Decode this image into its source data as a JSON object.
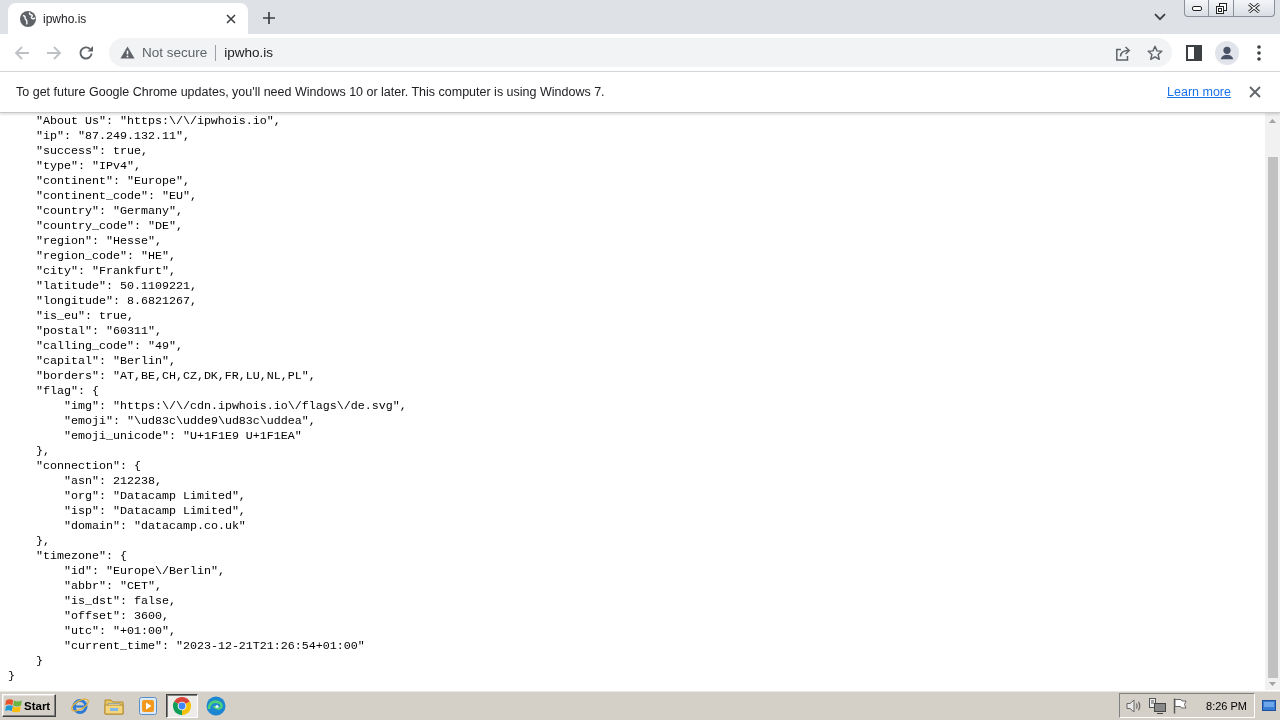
{
  "browser": {
    "tabs": [
      {
        "title": "ipwho.is",
        "selected": true
      }
    ],
    "toolbar": {
      "back": {
        "disabled": true
      },
      "forward": {
        "disabled": true
      }
    },
    "address_bar": {
      "security_label": "Not secure",
      "url": "ipwho.is"
    },
    "infobar": {
      "message": "To get future Google Chrome updates, you'll need Windows 10 or later. This computer is using Windows 7.",
      "link": "Learn more"
    }
  },
  "page": {
    "entries": [
      {
        "text": "\"About Us\": \"https:\\/\\/ipwhois.io\","
      },
      {
        "text": "\"ip\": \"87.249.132.11\","
      },
      {
        "text": "\"success\": true,"
      },
      {
        "text": "\"type\": \"IPv4\","
      },
      {
        "text": "\"continent\": \"Europe\","
      },
      {
        "text": "\"continent_code\": \"EU\","
      },
      {
        "text": "\"country\": \"Germany\","
      },
      {
        "text": "\"country_code\": \"DE\","
      },
      {
        "text": "\"region\": \"Hesse\","
      },
      {
        "text": "\"region_code\": \"HE\","
      },
      {
        "text": "\"city\": \"Frankfurt\","
      },
      {
        "text": "\"latitude\": 50.1109221,"
      },
      {
        "text": "\"longitude\": 8.6821267,"
      },
      {
        "text": "\"is_eu\": true,"
      },
      {
        "text": "\"postal\": \"60311\","
      },
      {
        "text": "\"calling_code\": \"49\","
      },
      {
        "text": "\"capital\": \"Berlin\","
      },
      {
        "text": "\"borders\": \"AT,BE,CH,CZ,DK,FR,LU,NL,PL\","
      },
      {
        "text": "\"flag\": {",
        "children": [
          {
            "text": "\"img\": \"https:\\/\\/cdn.ipwhois.io\\/flags\\/de.svg\","
          },
          {
            "text": "\"emoji\": \"\\ud83c\\udde9\\ud83c\\uddea\","
          },
          {
            "text": "\"emoji_unicode\": \"U+1F1E9 U+1F1EA\""
          }
        ],
        "close": "},"
      },
      {
        "text": "\"connection\": {",
        "children": [
          {
            "text": "\"asn\": 212238,"
          },
          {
            "text": "\"org\": \"Datacamp Limited\","
          },
          {
            "text": "\"isp\": \"Datacamp Limited\","
          },
          {
            "text": "\"domain\": \"datacamp.co.uk\""
          }
        ],
        "close": "},"
      },
      {
        "text": "\"timezone\": {",
        "children": [
          {
            "text": "\"id\": \"Europe\\/Berlin\","
          },
          {
            "text": "\"abbr\": \"CET\","
          },
          {
            "text": "\"is_dst\": false,"
          },
          {
            "text": "\"offset\": 3600,"
          },
          {
            "text": "\"utc\": \"+01:00\","
          },
          {
            "text": "\"current_time\": \"2023-12-21T21:26:54+01:00\""
          }
        ],
        "close": "}"
      }
    ],
    "close": "}"
  },
  "taskbar": {
    "start": "Start",
    "apps": [
      {
        "kind": "ie",
        "selected": false
      },
      {
        "kind": "folder",
        "selected": false
      },
      {
        "kind": "media",
        "selected": false
      },
      {
        "kind": "chrome",
        "selected": true
      },
      {
        "kind": "edge",
        "selected": false
      }
    ],
    "clock": "8:26 PM"
  }
}
